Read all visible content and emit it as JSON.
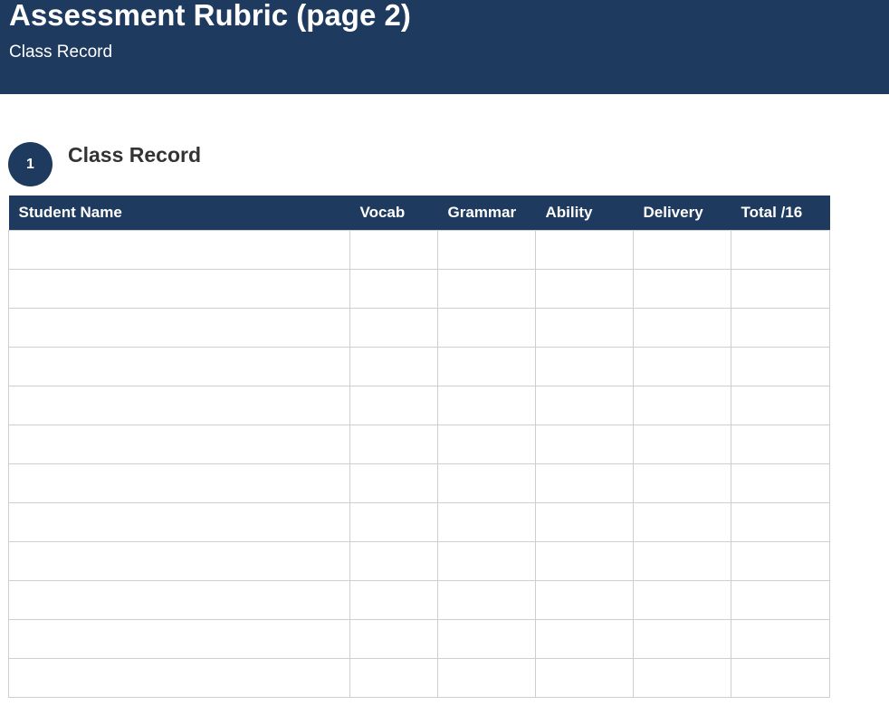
{
  "header": {
    "title": "Assessment Rubric (page 2)",
    "subtitle": "Class Record"
  },
  "section": {
    "number": "1",
    "title": "Class Record"
  },
  "table": {
    "columns": [
      "Student Name",
      "Vocab",
      "Grammar",
      "Ability",
      "Delivery",
      "Total /16"
    ],
    "rows": [
      [
        "",
        "",
        "",
        "",
        "",
        ""
      ],
      [
        "",
        "",
        "",
        "",
        "",
        ""
      ],
      [
        "",
        "",
        "",
        "",
        "",
        ""
      ],
      [
        "",
        "",
        "",
        "",
        "",
        ""
      ],
      [
        "",
        "",
        "",
        "",
        "",
        ""
      ],
      [
        "",
        "",
        "",
        "",
        "",
        ""
      ],
      [
        "",
        "",
        "",
        "",
        "",
        ""
      ],
      [
        "",
        "",
        "",
        "",
        "",
        ""
      ],
      [
        "",
        "",
        "",
        "",
        "",
        ""
      ],
      [
        "",
        "",
        "",
        "",
        "",
        ""
      ],
      [
        "",
        "",
        "",
        "",
        "",
        ""
      ],
      [
        "",
        "",
        "",
        "",
        "",
        ""
      ]
    ]
  },
  "colors": {
    "brand": "#1f3a5f",
    "text": "#333333",
    "grid": "#cfcfcf"
  }
}
